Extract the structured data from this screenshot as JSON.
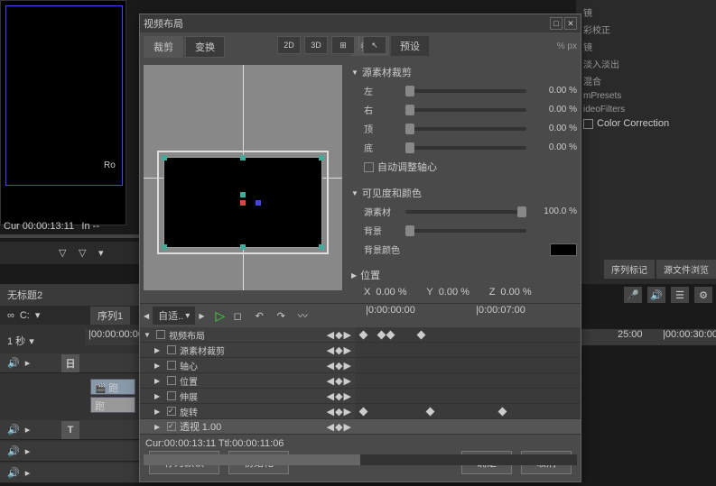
{
  "dialog": {
    "title": "视频布局",
    "tabs": {
      "crop": "裁剪",
      "transform": "变换"
    },
    "toolbar": {
      "mode2d": "2D",
      "mode3d": "3D"
    },
    "param_tabs": {
      "params": "参数",
      "presets": "预设"
    },
    "unit": "% px",
    "sections": {
      "source_crop": {
        "title": "源素材裁剪",
        "left": {
          "label": "左",
          "value": "0.00 %"
        },
        "right": {
          "label": "右",
          "value": "0.00 %"
        },
        "top": {
          "label": "顶",
          "value": "0.00 %"
        },
        "bottom": {
          "label": "底",
          "value": "0.00 %"
        },
        "auto_center": "自动调整轴心"
      },
      "visibility": {
        "title": "可见度和颜色",
        "source": {
          "label": "源素材",
          "value": "100.0 %"
        },
        "background": {
          "label": "背景"
        },
        "bg_color": {
          "label": "背景颜色"
        }
      },
      "position": {
        "title": "位置",
        "x": {
          "label": "X",
          "value": "0.00 %"
        },
        "y": {
          "label": "Y",
          "value": "0.00 %"
        },
        "z": {
          "label": "Z",
          "value": "0.00 %"
        }
      }
    },
    "timeline": {
      "fit_label": "自适..",
      "ruler": {
        "t0": "|0:00:00:00",
        "t1": "|0:00:07:00"
      },
      "tracks": {
        "root": "视频布局",
        "crop": "源素材裁剪",
        "center": "轴心",
        "position": "位置",
        "stretch": "伸展",
        "rotation": "旋转",
        "perspective": {
          "label": "透视",
          "value": "1.00"
        }
      },
      "status": {
        "cur": "Cur:00:00:13:11",
        "ttl": "Ttl:00:00:11:06"
      }
    },
    "footer": {
      "save_default": "存为默认",
      "reset": "初始化",
      "ok": "确定",
      "cancel": "取消"
    }
  },
  "background": {
    "monitor_label": "Ro",
    "timecode": {
      "cur": "Cur 00:00:13:11",
      "in": "In --"
    },
    "sequence_title": "无标题2",
    "sequence_tab": "序列1",
    "duration": "1 秒",
    "ruler": "|00:00:00:00",
    "ruler2_a": "25:00",
    "ruler2_b": "|00:00:30:00",
    "track_labels": {
      "ri": "日",
      "t": "T"
    },
    "clips": {
      "a": "跑",
      "b": "跑"
    },
    "right_panel": {
      "i1": "镜",
      "i2": "彩校正",
      "i3": "镜",
      "i4": "淡入淡出",
      "i5": "混合",
      "i6": "mPresets",
      "i7": "ideoFilters",
      "i8": "Color Correction"
    },
    "right_tabs": {
      "a": "序列标记",
      "b": "源文件浏览"
    }
  }
}
